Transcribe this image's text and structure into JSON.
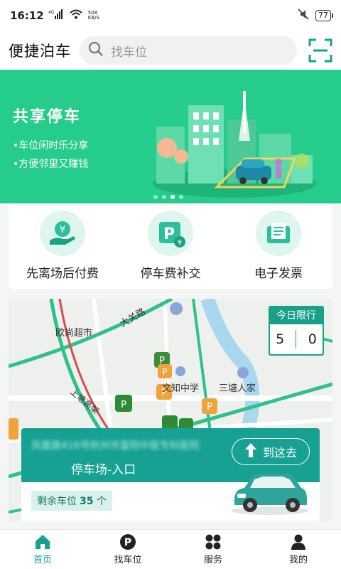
{
  "status_bar": {
    "time": "16:12",
    "net_speed_value": "508",
    "net_speed_unit": "KB/S",
    "network": "4G",
    "battery": "77"
  },
  "header": {
    "title": "便捷泊车",
    "search_placeholder": "找车位"
  },
  "banner": {
    "title": "共享停车",
    "lines": [
      "•车位闲时乐分享",
      "•方便邻里又赚钱"
    ],
    "page_count": 4,
    "active_page": 2
  },
  "services": [
    {
      "label": "先离场后付费",
      "icon": "yen-hand-icon"
    },
    {
      "label": "停车费补交",
      "icon": "parking-yen-icon"
    },
    {
      "label": "电子发票",
      "icon": "receipt-icon"
    }
  ],
  "map": {
    "labels": [
      "欧尚超市",
      "大关路",
      "文知中学",
      "三塘人家",
      "上塘高架"
    ],
    "today_limit": {
      "title": "今日限行",
      "nums": [
        "5",
        "0"
      ]
    },
    "card": {
      "address": "凤凰路416号杭州市富阳中医专科医院",
      "lot_name": "停车场-入口",
      "goto_label": "到这去",
      "remain_label": "剩余车位",
      "remain_value": "35",
      "remain_unit": "个"
    }
  },
  "tabbar": [
    {
      "label": "首页",
      "icon": "home-icon",
      "active": true
    },
    {
      "label": "找车位",
      "icon": "parking-icon",
      "active": false
    },
    {
      "label": "服务",
      "icon": "grid-icon",
      "active": false
    },
    {
      "label": "我的",
      "icon": "user-icon",
      "active": false
    }
  ],
  "colors": {
    "primary": "#17a193",
    "banner": "#25cc8c",
    "light": "#dff6ef"
  }
}
